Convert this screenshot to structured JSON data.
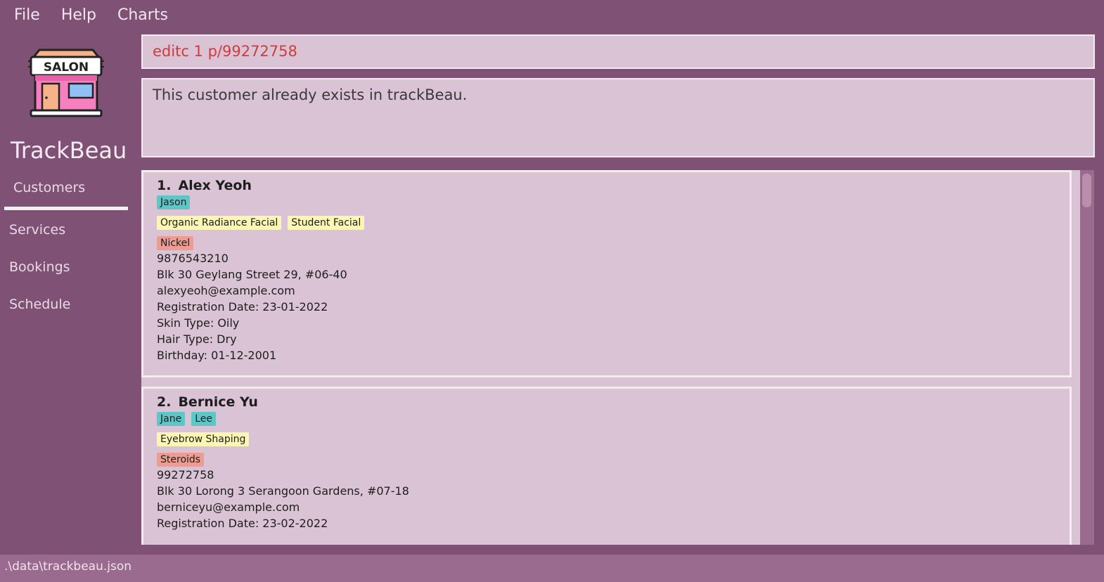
{
  "menu": {
    "file": "File",
    "help": "Help",
    "charts": "Charts"
  },
  "sidebar": {
    "logo_text": "SALON",
    "app_name": "TrackBeau",
    "items": [
      {
        "label": "Customers",
        "active": true
      },
      {
        "label": "Services",
        "active": false
      },
      {
        "label": "Bookings",
        "active": false
      },
      {
        "label": "Schedule",
        "active": false
      }
    ]
  },
  "command": {
    "text": "editc 1 p/99272758",
    "color": "#d23b3b"
  },
  "result": {
    "text": "This customer already exists in trackBeau."
  },
  "customers": [
    {
      "index": "1.",
      "name": "Alex Yeoh",
      "staff_tags": [
        "Jason"
      ],
      "service_tags": [
        "Organic Radiance Facial",
        "Student Facial"
      ],
      "allergy_tags": [
        "Nickel"
      ],
      "phone": "9876543210",
      "address": "Blk 30 Geylang Street 29, #06-40",
      "email": "alexyeoh@example.com",
      "registration": "Registration Date: 23-01-2022",
      "skin": "Skin Type: Oily",
      "hair": "Hair Type: Dry",
      "birthday": "Birthday: 01-12-2001"
    },
    {
      "index": "2.",
      "name": "Bernice Yu",
      "staff_tags": [
        "Jane",
        "Lee"
      ],
      "service_tags": [
        "Eyebrow Shaping"
      ],
      "allergy_tags": [
        "Steroids"
      ],
      "phone": "99272758",
      "address": "Blk 30 Lorong 3 Serangoon Gardens, #07-18",
      "email": "berniceyu@example.com",
      "registration": "Registration Date: 23-02-2022"
    }
  ],
  "status": {
    "path": ".\\data\\trackbeau.json"
  },
  "colors": {
    "accent": "#7f5174",
    "panel": "#d9c3d4",
    "staff_tag": "#5fc6c8",
    "service_tag": "#fbf6b3",
    "allergy_tag": "#ee9b92"
  }
}
